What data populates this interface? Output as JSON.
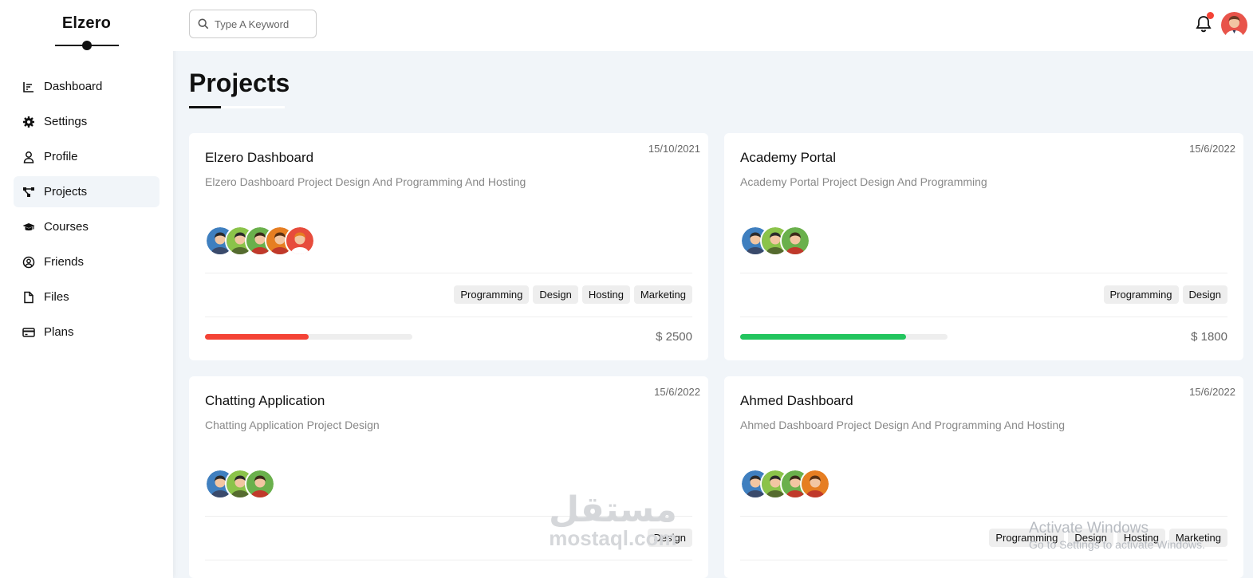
{
  "brand": {
    "name": "Elzero"
  },
  "sidebar": {
    "items": [
      {
        "label": "Dashboard",
        "icon": "chart-line-icon"
      },
      {
        "label": "Settings",
        "icon": "gear-icon"
      },
      {
        "label": "Profile",
        "icon": "user-icon"
      },
      {
        "label": "Projects",
        "icon": "diagram-project-icon",
        "active": true
      },
      {
        "label": "Courses",
        "icon": "graduation-cap-icon"
      },
      {
        "label": "Friends",
        "icon": "circle-user-icon"
      },
      {
        "label": "Files",
        "icon": "file-icon"
      },
      {
        "label": "Plans",
        "icon": "credit-card-icon"
      }
    ]
  },
  "header": {
    "search_placeholder": "Type A Keyword",
    "notification_color": "#f44336"
  },
  "page": {
    "title": "Projects"
  },
  "projects": [
    {
      "name": "Elzero Dashboard",
      "date": "15/10/2021",
      "description": "Elzero Dashboard Project Design And Programming And Hosting",
      "team_count": 5,
      "tags": [
        "Programming",
        "Design",
        "Hosting",
        "Marketing"
      ],
      "progress": 0.5,
      "progress_color": "#f44336",
      "price": "$ 2500"
    },
    {
      "name": "Academy Portal",
      "date": "15/6/2022",
      "description": "Academy Portal Project Design And Programming",
      "team_count": 3,
      "tags": [
        "Programming",
        "Design"
      ],
      "progress": 0.8,
      "progress_color": "#22c55e",
      "price": "$ 1800"
    },
    {
      "name": "Chatting Application",
      "date": "15/6/2022",
      "description": "Chatting Application Project Design",
      "team_count": 3,
      "tags": [
        "Design"
      ],
      "progress": null,
      "progress_color": "#0075ff",
      "price": ""
    },
    {
      "name": "Ahmed Dashboard",
      "date": "15/6/2022",
      "description": "Ahmed Dashboard Project Design And Programming And Hosting",
      "team_count": 4,
      "tags": [
        "Programming",
        "Design",
        "Hosting",
        "Marketing"
      ],
      "progress": null,
      "progress_color": "#0075ff",
      "price": ""
    }
  ],
  "overlays": {
    "activate_line1": "Activate Windows",
    "activate_line2": "Go to Settings to activate Windows.",
    "logo_ar": "مستقل",
    "logo_en": "mostaql.com"
  }
}
